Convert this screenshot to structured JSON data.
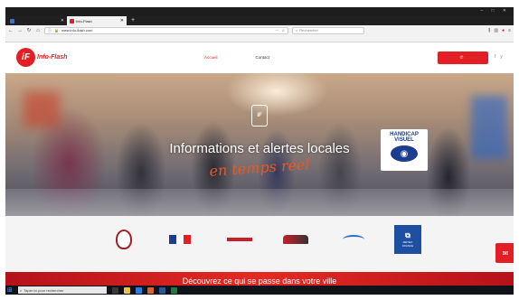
{
  "os": {
    "menu": [],
    "window_controls": "–  □  ✕"
  },
  "tabs": [
    {
      "label": "",
      "color": "#3a6fd8",
      "active": false
    },
    {
      "label": "Info-Flash",
      "color": "#e31e24",
      "active": true
    }
  ],
  "newtab": "+",
  "navbar": {
    "url": "www.info-flash.com",
    "search_placeholder": "Rechercher"
  },
  "bookmarks": [],
  "site": {
    "logo_mark": "iF",
    "logo_text": "Info-Flash",
    "nav": [
      "Accueil",
      "",
      "",
      "Contact"
    ],
    "phone": "",
    "socials": [
      "f",
      "y"
    ]
  },
  "hero": {
    "phone_icon": "iF",
    "title": "Informations et alertes locales",
    "subtitle": "en temps réel",
    "badge_line1": "HANDICAP",
    "badge_line2": "VISUEL"
  },
  "partners": {
    "meteo_line1": "METEO",
    "meteo_line2": "FRANCE"
  },
  "band_text": "Découvrez ce qui se passe dans votre ville",
  "taskbar": {
    "search_text": "Taper ici pour rechercher",
    "tray": ""
  },
  "colors": {
    "brand_red": "#e31e24",
    "handicap_blue": "#1a3d8f",
    "meteo_blue": "#1e4fa0"
  }
}
